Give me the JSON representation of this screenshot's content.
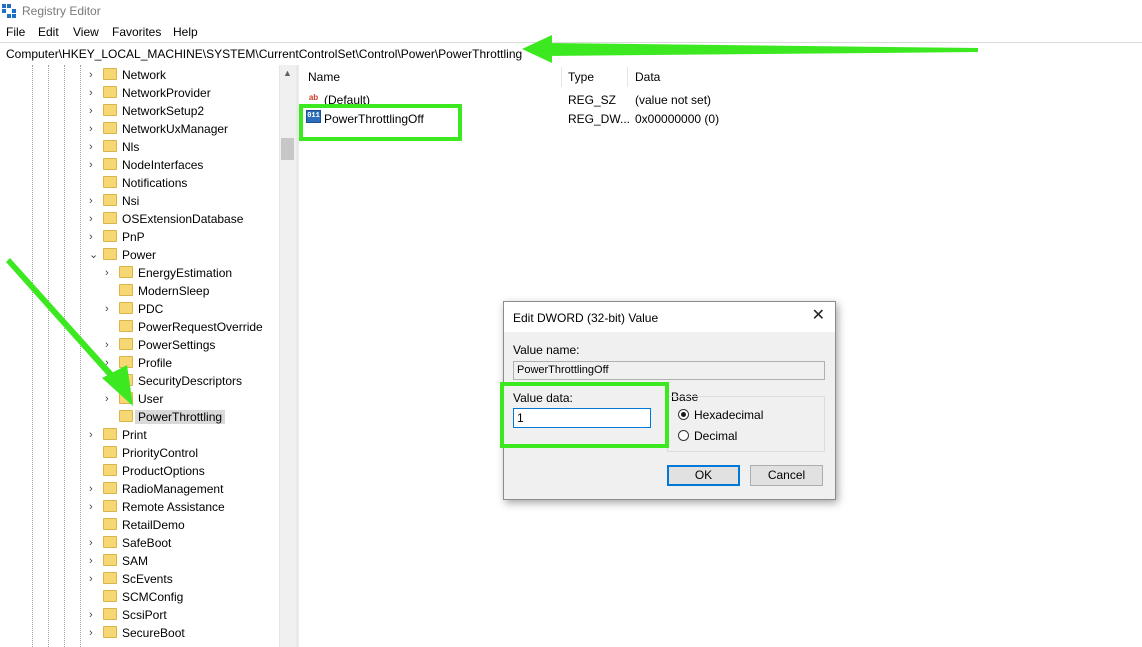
{
  "window": {
    "title": "Registry Editor",
    "icon": "registry-editor-icon"
  },
  "menu": [
    "File",
    "Edit",
    "View",
    "Favorites",
    "Help"
  ],
  "address": "Computer\\HKEY_LOCAL_MACHINE\\SYSTEM\\CurrentControlSet\\Control\\Power\\PowerThrottling",
  "tree": {
    "items": [
      {
        "label": "Network",
        "level": 0,
        "expander": "collapsed"
      },
      {
        "label": "NetworkProvider",
        "level": 0,
        "expander": "collapsed"
      },
      {
        "label": "NetworkSetup2",
        "level": 0,
        "expander": "collapsed"
      },
      {
        "label": "NetworkUxManager",
        "level": 0,
        "expander": "collapsed"
      },
      {
        "label": "Nls",
        "level": 0,
        "expander": "collapsed"
      },
      {
        "label": "NodeInterfaces",
        "level": 0,
        "expander": "collapsed"
      },
      {
        "label": "Notifications",
        "level": 0,
        "expander": "none"
      },
      {
        "label": "Nsi",
        "level": 0,
        "expander": "collapsed"
      },
      {
        "label": "OSExtensionDatabase",
        "level": 0,
        "expander": "collapsed"
      },
      {
        "label": "PnP",
        "level": 0,
        "expander": "collapsed"
      },
      {
        "label": "Power",
        "level": 0,
        "expander": "expanded"
      },
      {
        "label": "EnergyEstimation",
        "level": 1,
        "expander": "collapsed"
      },
      {
        "label": "ModernSleep",
        "level": 1,
        "expander": "none"
      },
      {
        "label": "PDC",
        "level": 1,
        "expander": "collapsed"
      },
      {
        "label": "PowerRequestOverride",
        "level": 1,
        "expander": "none"
      },
      {
        "label": "PowerSettings",
        "level": 1,
        "expander": "collapsed"
      },
      {
        "label": "Profile",
        "level": 1,
        "expander": "collapsed"
      },
      {
        "label": "SecurityDescriptors",
        "level": 1,
        "expander": "none"
      },
      {
        "label": "User",
        "level": 1,
        "expander": "collapsed"
      },
      {
        "label": "PowerThrottling",
        "level": 1,
        "expander": "none",
        "selected": true
      },
      {
        "label": "Print",
        "level": 0,
        "expander": "collapsed"
      },
      {
        "label": "PriorityControl",
        "level": 0,
        "expander": "none"
      },
      {
        "label": "ProductOptions",
        "level": 0,
        "expander": "none"
      },
      {
        "label": "RadioManagement",
        "level": 0,
        "expander": "collapsed"
      },
      {
        "label": "Remote Assistance",
        "level": 0,
        "expander": "collapsed"
      },
      {
        "label": "RetailDemo",
        "level": 0,
        "expander": "none"
      },
      {
        "label": "SafeBoot",
        "level": 0,
        "expander": "collapsed"
      },
      {
        "label": "SAM",
        "level": 0,
        "expander": "collapsed"
      },
      {
        "label": "ScEvents",
        "level": 0,
        "expander": "collapsed"
      },
      {
        "label": "SCMConfig",
        "level": 0,
        "expander": "none"
      },
      {
        "label": "ScsiPort",
        "level": 0,
        "expander": "collapsed"
      },
      {
        "label": "SecureBoot",
        "level": 0,
        "expander": "collapsed"
      }
    ]
  },
  "list": {
    "columns": [
      "Name",
      "Type",
      "Data"
    ],
    "rows": [
      {
        "name": "(Default)",
        "type": "REG_SZ",
        "data": "(value not set)",
        "icon": "string-value-icon"
      },
      {
        "name": "PowerThrottlingOff",
        "type": "REG_DW...",
        "data": "0x00000000 (0)",
        "icon": "dword-value-icon"
      }
    ]
  },
  "dialog": {
    "title": "Edit DWORD (32-bit) Value",
    "value_name_label": "Value name:",
    "value_name": "PowerThrottlingOff",
    "value_data_label": "Value data:",
    "value_data": "1",
    "base_label": "Base",
    "base_options": [
      {
        "label": "Hexadecimal",
        "selected": true
      },
      {
        "label": "Decimal",
        "selected": false
      }
    ],
    "ok_label": "OK",
    "cancel_label": "Cancel"
  },
  "annotation_color": "#3ce81f"
}
